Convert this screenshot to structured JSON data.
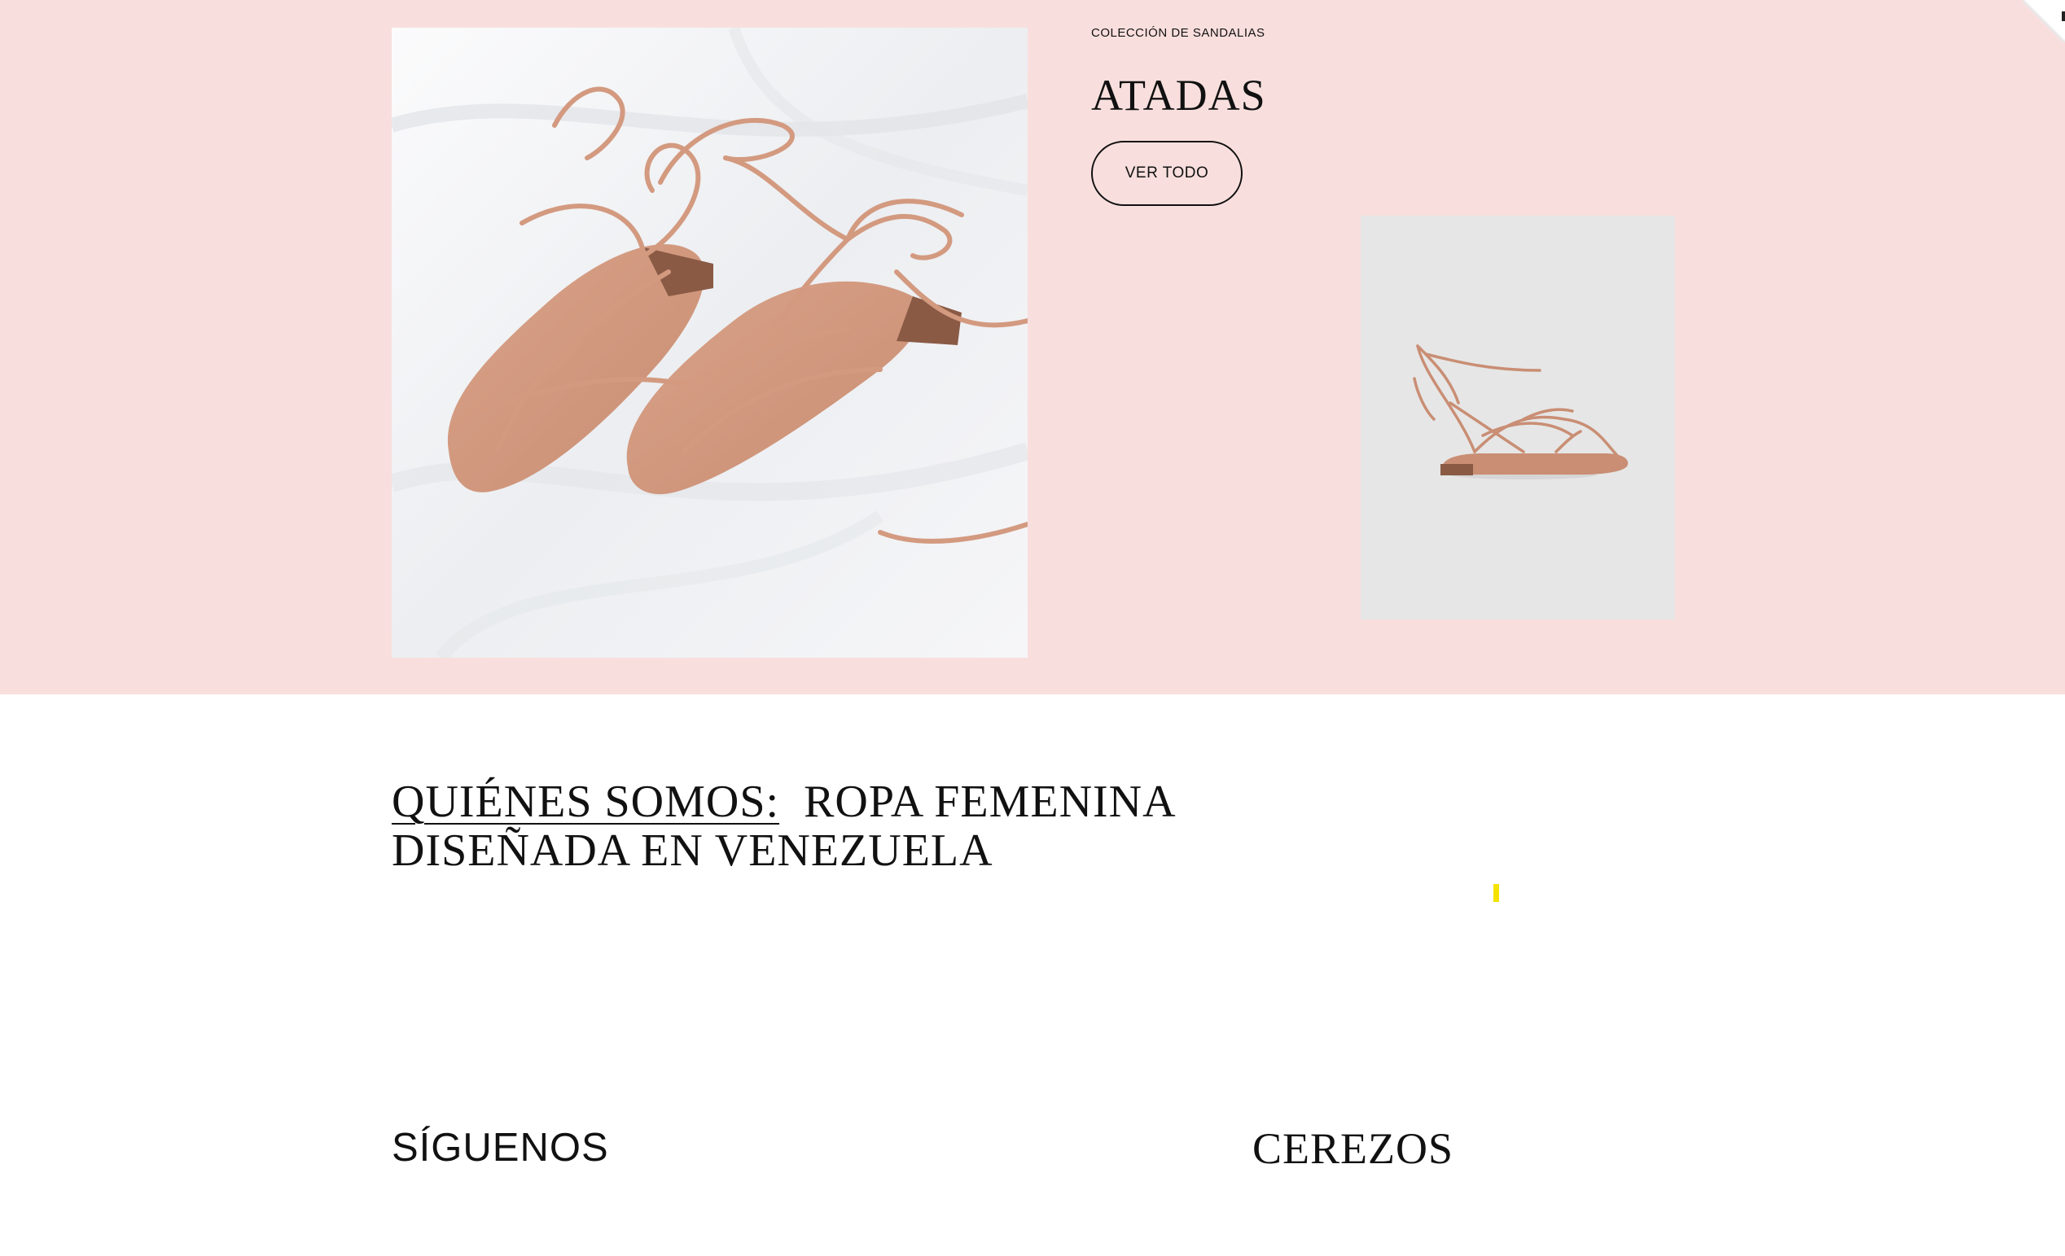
{
  "hero": {
    "collection_label": "COLECCIÓN DE SANDALIAS",
    "title": "ATADAS",
    "view_all_label": "VER TODO",
    "background_color": "#f8dfdd"
  },
  "about": {
    "link_text": "QUIÉNES SOMOS:",
    "heading_line1": "ROPA FEMENINA",
    "heading_line2": "DISEÑADA EN VENEZUELA"
  },
  "footer": {
    "follow_heading": "SÍGUENOS",
    "brand_name": "CEREZOS"
  },
  "colors": {
    "accent_yellow": "#f5e200",
    "text": "#111111",
    "sandal": "#d39a80"
  }
}
